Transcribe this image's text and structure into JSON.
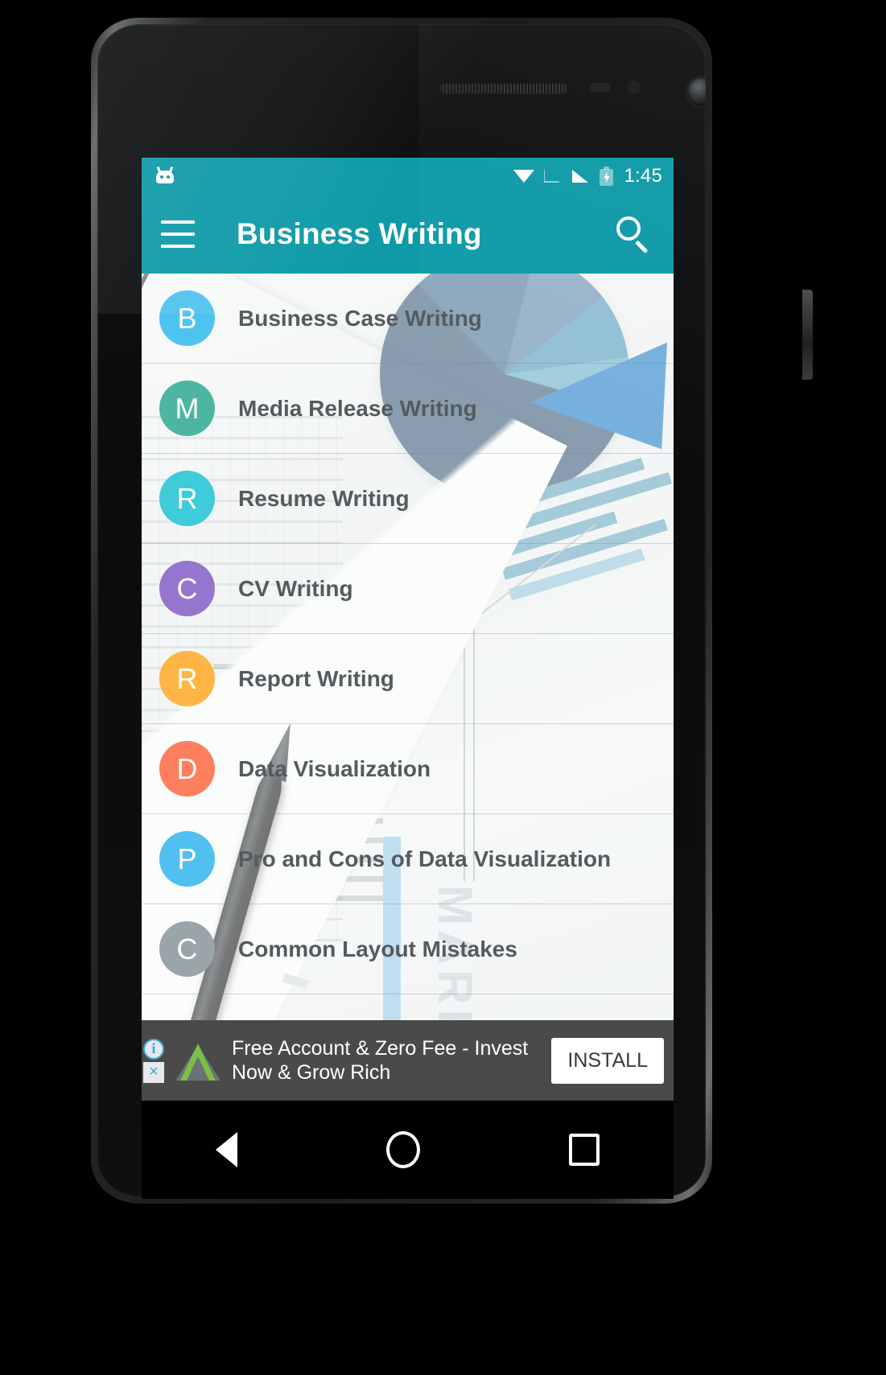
{
  "status_bar": {
    "notification_icon": "android-robot-icon",
    "icons": [
      "wifi-icon",
      "signal-empty-icon",
      "signal-full-icon",
      "battery-charging-icon"
    ],
    "time": "1:45"
  },
  "app_bar": {
    "menu_icon": "hamburger-menu-icon",
    "title": "Business Writing",
    "search_icon": "search-icon"
  },
  "list": {
    "items": [
      {
        "initial": "B",
        "label": "Business Case Writing",
        "color": "#4FC3EF"
      },
      {
        "initial": "M",
        "label": "Media Release Writing",
        "color": "#4DB6A0"
      },
      {
        "initial": "R",
        "label": "Resume Writing",
        "color": "#3FCBD9"
      },
      {
        "initial": "C",
        "label": "CV Writing",
        "color": "#9濃"
      },
      {
        "initial": "R",
        "label": "Report Writing",
        "color": "#FFB545"
      },
      {
        "initial": "D",
        "label": "Data Visualization",
        "color": "#FD7F5E"
      },
      {
        "initial": "P",
        "label": "Pro and Cons of Data Visualization",
        "color": "#4FC0F0"
      },
      {
        "initial": "C",
        "label": "Common Layout Mistakes",
        "color": "#9AA5AA"
      }
    ]
  },
  "ad_banner": {
    "info_icon": "ad-info-icon",
    "info_glyph": "i",
    "close_icon": "ad-close-icon",
    "close_glyph": "×",
    "advertiser_logo": "green-triangle-logo-icon",
    "text": "Free Account & Zero Fee - Invest Now & Grow Rich",
    "install_label": "INSTALL"
  },
  "nav_bar": {
    "back_icon": "nav-back-icon",
    "home_icon": "nav-home-icon",
    "recents_icon": "nav-recents-icon"
  },
  "theme": {
    "primary": "#0f9aa8",
    "status_bar": "#0f9aa8",
    "ad_background": "#4a4a4a",
    "list_text": "#545b5e"
  }
}
